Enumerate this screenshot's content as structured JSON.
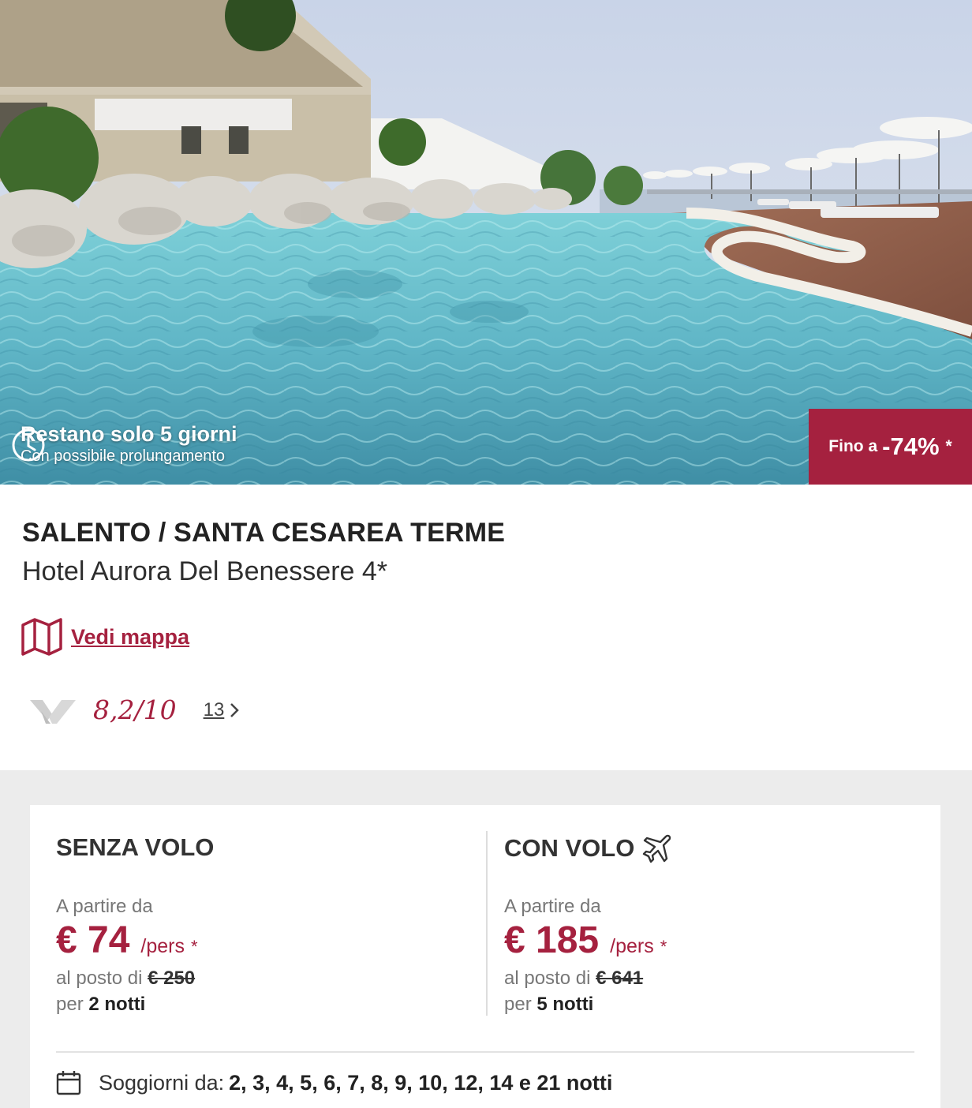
{
  "hero": {
    "image_alt": "Piscina a sfioro con rocce e ombrelloni vista mare",
    "countdown_title": "Restano solo 5 giorni",
    "countdown_subtitle": "Con possibile prolungamento",
    "discount_prefix": "Fino a",
    "discount_value": "-74%",
    "discount_asterisk": "*"
  },
  "offer": {
    "region": "SALENTO / SANTA CESAREA TERME",
    "hotel_name": "Hotel Aurora Del Benessere 4*",
    "map_link": "Vedi mappa",
    "rating_score": "8,2/10",
    "review_count": "13"
  },
  "pricing": {
    "without_flight": {
      "title": "SENZA VOLO",
      "from_label": "A partire da",
      "price": "€ 74",
      "per_label": "/pers",
      "asterisk": "*",
      "instead_label": "al posto di",
      "old_price": "€ 250",
      "per_prefix": "per",
      "nights": "2 notti"
    },
    "with_flight": {
      "title": "CON VOLO",
      "from_label": "A partire da",
      "price": "€ 185",
      "per_label": "/pers",
      "asterisk": "*",
      "instead_label": "al posto di",
      "old_price": "€ 641",
      "per_prefix": "per",
      "nights": "5 notti"
    },
    "stays_label": "Soggiorni da:",
    "stays_values": "2, 3, 4, 5, 6, 7, 8, 9, 10, 12, 14 e 21 notti"
  },
  "colors": {
    "accent": "#a5213f",
    "background_band": "#ececec"
  }
}
